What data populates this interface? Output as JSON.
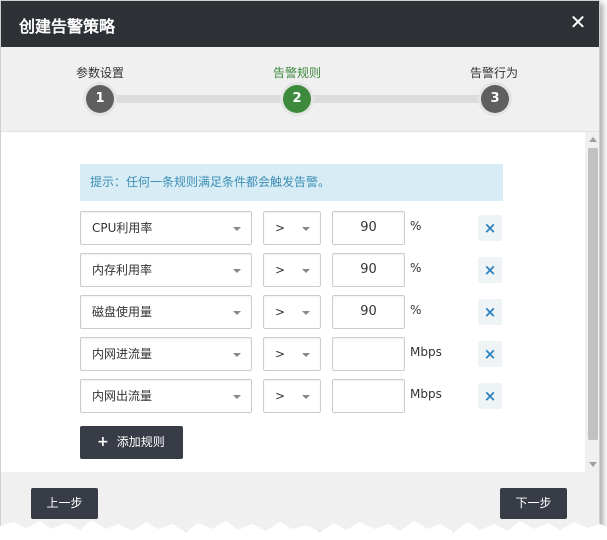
{
  "dialog": {
    "title": "创建告警策略",
    "close_glyph": "✕"
  },
  "steps": [
    {
      "label": "参数设置",
      "number": "1",
      "active": false
    },
    {
      "label": "告警规则",
      "number": "2",
      "active": true
    },
    {
      "label": "告警行为",
      "number": "3",
      "active": false
    }
  ],
  "notice": "提示：任何一条规则满足条件都会触发告警。",
  "rules": [
    {
      "metric": "CPU利用率",
      "operator": ">",
      "value": "90",
      "unit": "%"
    },
    {
      "metric": "内存利用率",
      "operator": ">",
      "value": "90",
      "unit": "%"
    },
    {
      "metric": "磁盘使用量",
      "operator": ">",
      "value": "90",
      "unit": "%"
    },
    {
      "metric": "内网进流量",
      "operator": ">",
      "value": "",
      "unit": "Mbps"
    },
    {
      "metric": "内网出流量",
      "operator": ">",
      "value": "",
      "unit": "Mbps"
    }
  ],
  "delete_glyph": "×",
  "add_rule": {
    "plus": "+",
    "label": "添加规则"
  },
  "footer": {
    "prev_label": "上一步",
    "next_label": "下一步"
  },
  "icons": [
    "close-icon",
    "chevron-down-icon",
    "delete-icon",
    "plus-icon",
    "scroll-up-icon",
    "scroll-down-icon"
  ],
  "colors": {
    "titlebar": "#2d3035",
    "active_step": "#3d8a3d",
    "inactive_step": "#5f5f5f",
    "notice_bg": "#d7ecf5",
    "notice_text": "#3e8fb5",
    "button": "#383c47",
    "delete": "#2d82c0"
  }
}
